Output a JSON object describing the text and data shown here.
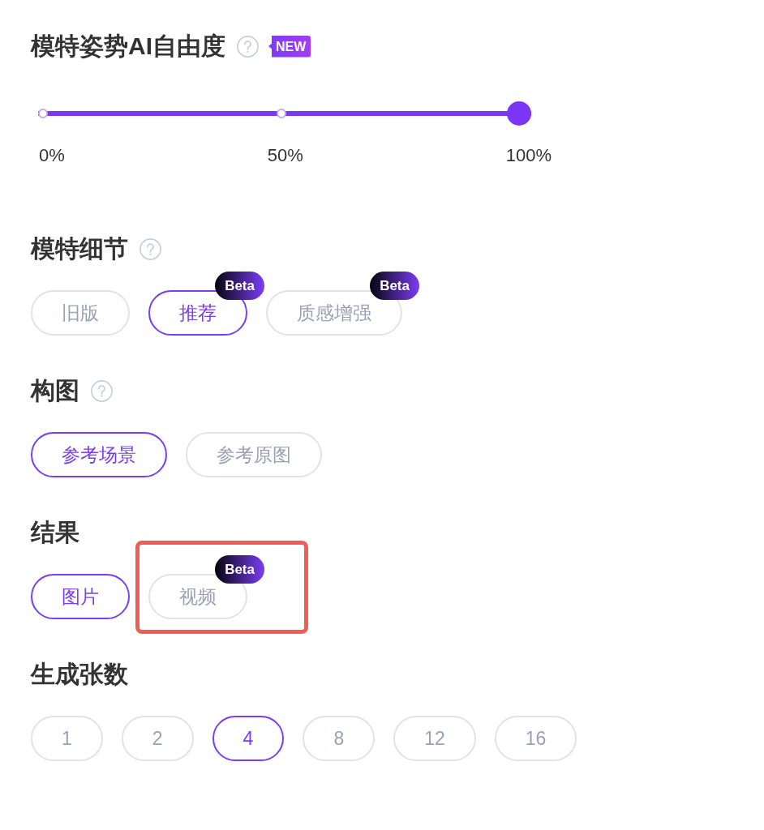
{
  "sections": [
    {
      "kind": "slider",
      "title": "模特姿势AI自由度",
      "help": true,
      "badge": "NEW",
      "level": 1,
      "marks": [
        {
          "label": "0%"
        },
        {
          "label": "50%"
        },
        {
          "label": "100%"
        }
      ]
    },
    {
      "kind": "options",
      "title": "模特细节",
      "help": true,
      "options": [
        {
          "label": "旧版",
          "selected": false
        },
        {
          "label": "推荐",
          "selected": true,
          "badge": "Beta"
        },
        {
          "label": "质感增强",
          "selected": false,
          "badge": "Beta"
        }
      ]
    },
    {
      "kind": "options",
      "title": "构图",
      "help": true,
      "options": [
        {
          "label": "参考场景",
          "selected": true
        },
        {
          "label": "参考原图",
          "selected": false
        }
      ]
    },
    {
      "kind": "options",
      "title": "结果",
      "help": false,
      "options": [
        {
          "label": "图片",
          "selected": true,
          "highlighted": false
        },
        {
          "label": "视频",
          "selected": false,
          "highlighted": true,
          "badge": "Beta"
        }
      ]
    },
    {
      "kind": "options",
      "title": "生成张数",
      "help": false,
      "options": [
        {
          "label": "1",
          "selected": false
        },
        {
          "label": "2",
          "selected": false
        },
        {
          "label": "4",
          "selected": true
        },
        {
          "label": "8",
          "selected": false
        },
        {
          "label": "12",
          "selected": false
        },
        {
          "label": "16",
          "selected": false
        }
      ]
    }
  ]
}
